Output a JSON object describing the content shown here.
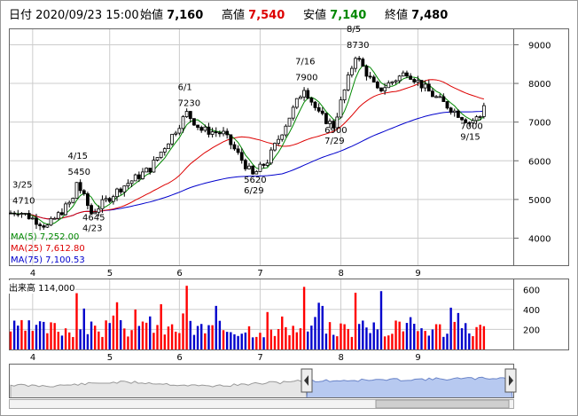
{
  "header": {
    "period_label": "日付",
    "datetime": "2020/09/23 15:00",
    "open_label": "始値",
    "open_value": "7,160",
    "high_label": "高値",
    "high_value": "7,540",
    "low_label": "安値",
    "low_value": "7,140",
    "close_label": "終値",
    "close_value": "7,480"
  },
  "colors": {
    "up": "#ff0000",
    "down": "#0000cc",
    "high": "#dd0000",
    "low": "#008800",
    "ma5": "#008800",
    "ma25": "#dd0000",
    "ma75": "#0000cc",
    "grid": "#cccccc"
  },
  "ma_legend": {
    "ma5": "MA(5)   7,252.00",
    "ma25": "MA(25)  7,612.80",
    "ma75": "MA(75)  7,100.53"
  },
  "volume_label": "出来高  114,000",
  "chart_data": [
    {
      "type": "candlestick",
      "y_ticks": [
        4000,
        5000,
        6000,
        7000,
        8000,
        9000
      ],
      "ylim": [
        3300,
        9400
      ],
      "x_ticks": [
        "4",
        "5",
        "6",
        "7",
        "8",
        "9"
      ],
      "annotations": [
        {
          "text": "3/25",
          "value": 4710
        },
        {
          "text": "4710",
          "value": 4710
        },
        {
          "text": "4/15",
          "value": 5450
        },
        {
          "text": "5450",
          "value": 5450
        },
        {
          "text": "4645",
          "value": 4645
        },
        {
          "text": "4/23",
          "value": 4645
        },
        {
          "text": "6/1",
          "value": 7230
        },
        {
          "text": "7230",
          "value": 7230
        },
        {
          "text": "5620",
          "value": 5620
        },
        {
          "text": "6/29",
          "value": 5620
        },
        {
          "text": "7/16",
          "value": 7900
        },
        {
          "text": "7900",
          "value": 7900
        },
        {
          "text": "8/5",
          "value": 8730
        },
        {
          "text": "8730",
          "value": 8730
        },
        {
          "text": "6900",
          "value": 6900
        },
        {
          "text": "7/29",
          "value": 6900
        },
        {
          "text": "7000",
          "value": 7000
        },
        {
          "text": "9/15",
          "value": 7000
        }
      ]
    },
    {
      "type": "bar",
      "name": "volume",
      "y_ticks": [
        200,
        400,
        600
      ],
      "ylim": [
        0,
        700
      ],
      "x_ticks": [
        "4",
        "5",
        "6",
        "7",
        "8",
        "9"
      ]
    },
    {
      "type": "area",
      "name": "navigator",
      "x_ticks": [
        "7",
        "9",
        "11",
        "20/1",
        "3",
        "5",
        "7",
        "9"
      ]
    }
  ]
}
